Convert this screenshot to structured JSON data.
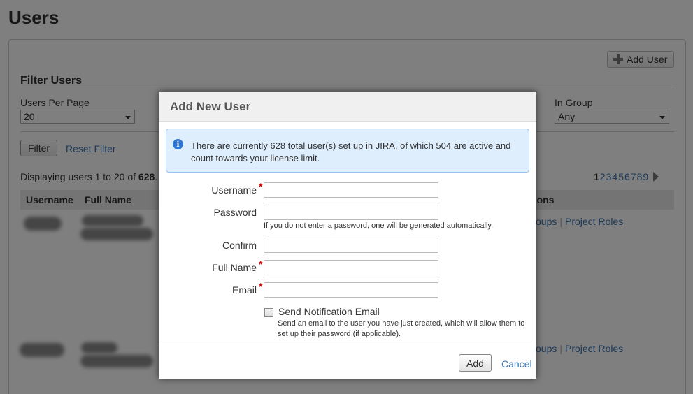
{
  "page": {
    "title": "Users",
    "add_user_label": "Add User"
  },
  "filter": {
    "title": "Filter Users",
    "users_per_page_label": "Users Per Page",
    "users_per_page_value": "20",
    "in_group_label": "In Group",
    "in_group_value": "Any",
    "filter_button": "Filter",
    "reset_link": "Reset Filter"
  },
  "listing": {
    "displaying_prefix": "Displaying users ",
    "displaying_range": "1 to 20",
    "displaying_of": " of ",
    "displaying_total": "628",
    "displaying_suffix": ".",
    "pager": {
      "current": "1",
      "pages": [
        "2",
        "3",
        "4",
        "5",
        "6",
        "7",
        "8",
        "9"
      ]
    },
    "columns": {
      "username": "Username",
      "full_name": "Full Name",
      "operations_partial": "tions"
    },
    "row_ops": {
      "groups_partial": "oups",
      "project_roles": "Project Roles"
    }
  },
  "dialog": {
    "title": "Add New User",
    "info_text": "There are currently 628 total user(s) set up in JIRA, of which 504 are active and count towards your license limit.",
    "fields": {
      "username_label": "Username",
      "password_label": "Password",
      "password_hint": "If you do not enter a password, one will be generated automatically.",
      "confirm_label": "Confirm",
      "full_name_label": "Full Name",
      "email_label": "Email",
      "required_marker": "*"
    },
    "notify": {
      "label": "Send Notification Email",
      "checked": false,
      "hint_line1": "Send an email to the user you have just created, which will allow them to",
      "hint_line2": "set up their password (if applicable)."
    },
    "add_button": "Add",
    "cancel_link": "Cancel"
  },
  "colors": {
    "link": "#3b73af",
    "required": "#cc0000",
    "info_bg": "#dfeefd",
    "info_icon": "#2c76d6"
  }
}
